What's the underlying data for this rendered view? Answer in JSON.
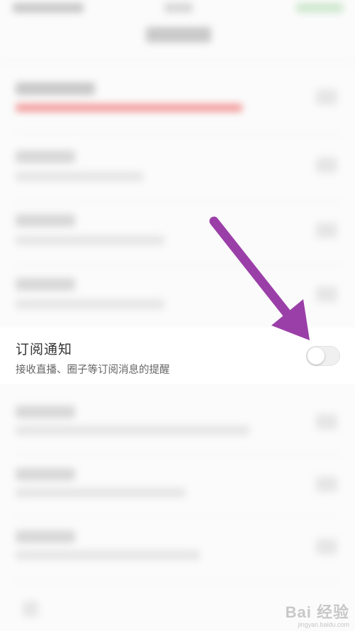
{
  "subscription_setting": {
    "title": "订阅通知",
    "description": "接收直播、圈子等订阅消息的提醒",
    "toggle_on": false
  },
  "annotation": {
    "arrow_color": "#9b3fa8"
  },
  "watermark": {
    "logo_text": "Bai 经验",
    "domain": "jingyan.baidu.com"
  }
}
